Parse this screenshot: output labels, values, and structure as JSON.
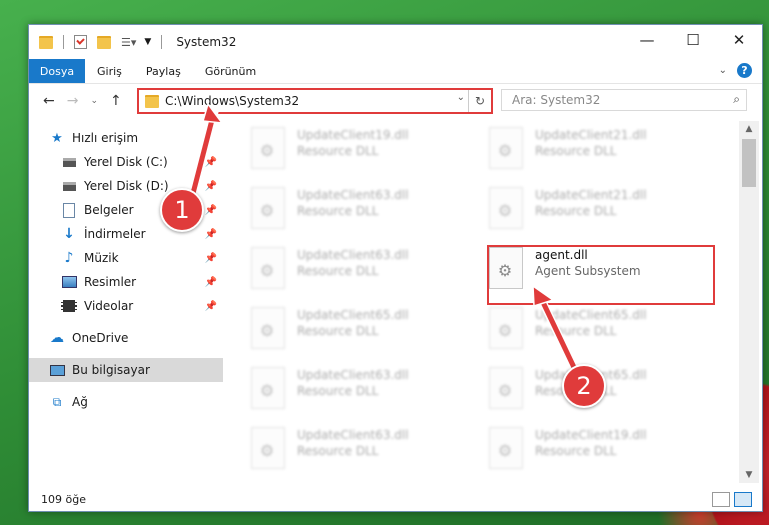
{
  "window": {
    "title": "System32"
  },
  "ribbon": {
    "tabs": [
      "Dosya",
      "Giriş",
      "Paylaş",
      "Görünüm"
    ]
  },
  "nav": {
    "address": "C:\\Windows\\System32",
    "search_placeholder": "Ara: System32"
  },
  "sidebar": {
    "items": [
      {
        "label": "Hızlı erişim",
        "icon": "star-icon",
        "pinned": false
      },
      {
        "label": "Yerel Disk (C:)",
        "icon": "drive-icon",
        "pinned": true
      },
      {
        "label": "Yerel Disk (D:)",
        "icon": "drive-icon",
        "pinned": true
      },
      {
        "label": "Belgeler",
        "icon": "documents-icon",
        "pinned": true
      },
      {
        "label": "İndirmeler",
        "icon": "download-icon",
        "pinned": true
      },
      {
        "label": "Müzik",
        "icon": "music-icon",
        "pinned": true
      },
      {
        "label": "Resimler",
        "icon": "pictures-icon",
        "pinned": true
      },
      {
        "label": "Videolar",
        "icon": "video-icon",
        "pinned": true
      },
      {
        "label": "OneDrive",
        "icon": "cloud-icon",
        "pinned": false
      },
      {
        "label": "Bu bilgisayar",
        "icon": "computer-icon",
        "pinned": false
      },
      {
        "label": "Ağ",
        "icon": "network-icon",
        "pinned": false
      }
    ]
  },
  "files": [
    {
      "name": "UpdateClient19.dll",
      "desc": "Resource DLL"
    },
    {
      "name": "UpdateClient21.dll",
      "desc": "Resource DLL"
    },
    {
      "name": "UpdateClient63.dll",
      "desc": "Resource DLL"
    },
    {
      "name": "UpdateClient21.dll",
      "desc": "Resource DLL"
    },
    {
      "name": "UpdateClient63.dll",
      "desc": "Resource DLL"
    },
    {
      "name": "agent.dll",
      "desc": "Agent Subsystem"
    },
    {
      "name": "UpdateClient65.dll",
      "desc": "Resource DLL"
    },
    {
      "name": "UpdateClient65.dll",
      "desc": "Resource DLL"
    },
    {
      "name": "UpdateClient63.dll",
      "desc": "Resource DLL"
    },
    {
      "name": "UpdateClient65.dll",
      "desc": "Resource DLL"
    },
    {
      "name": "UpdateClient63.dll",
      "desc": "Resource DLL"
    },
    {
      "name": "UpdateClient19.dll",
      "desc": "Resource DLL"
    }
  ],
  "status": {
    "count": "109 öğe"
  },
  "annotations": {
    "step1": "1",
    "step2": "2",
    "color": "#e03b3b"
  }
}
